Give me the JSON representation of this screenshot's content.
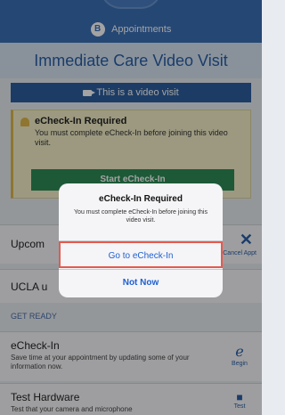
{
  "header": {
    "logo_letter": "B",
    "appointments_label": "Appointments"
  },
  "page": {
    "title": "Immediate Care Video Visit",
    "video_banner": "This is a video visit"
  },
  "echeck_card": {
    "title": "eCheck-In Required",
    "message": "You must complete eCheck-In before joining this video visit.",
    "start_button": "Start eCheck-In"
  },
  "rows": {
    "upcoming_label": "Upcom",
    "cancel_label": "Cancel Appt",
    "ucla_label": "UCLA u"
  },
  "get_ready": {
    "heading": "GET READY",
    "echeck_title": "eCheck-In",
    "echeck_desc": "Save time at your appointment by updating some of your information now.",
    "echeck_action": "Begin",
    "hardware_title": "Test Hardware",
    "hardware_desc": "Test that your camera and microphone",
    "hardware_action": "Test"
  },
  "dialog": {
    "title": "eCheck-In Required",
    "message": "You must complete eCheck-In before joining this video visit.",
    "primary_action": "Go to eCheck-In",
    "secondary_action": "Not Now"
  },
  "colors": {
    "brand_blue": "#3b6fb6",
    "start_green": "#2e8b57",
    "highlight_red": "#e55a4e",
    "warning_yellow": "#f4f0c9"
  }
}
